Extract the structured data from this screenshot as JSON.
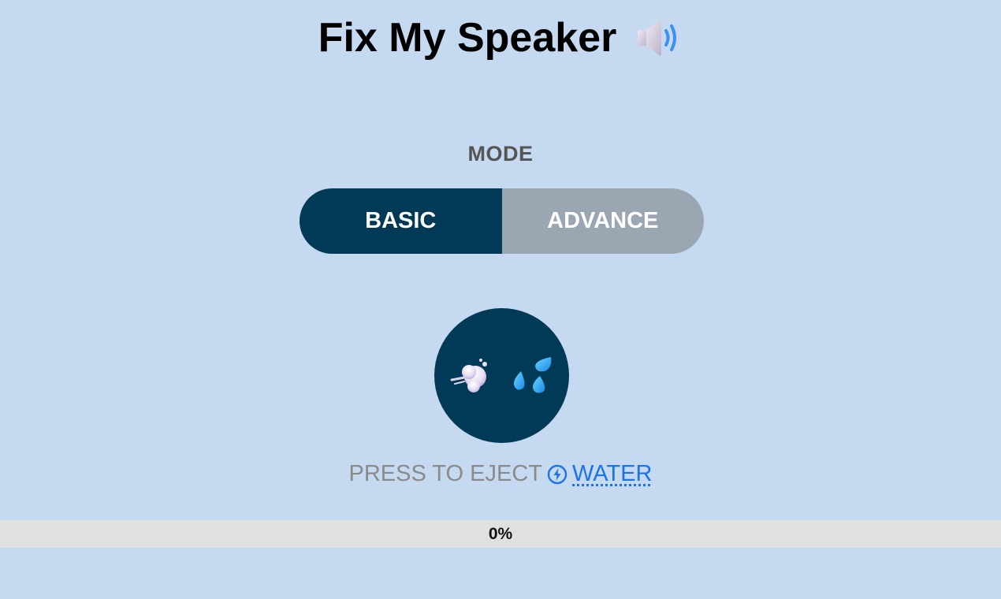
{
  "header": {
    "title": "Fix My Speaker",
    "icon": "speaker-high-volume-icon"
  },
  "mode": {
    "label": "MODE",
    "options": [
      "BASIC",
      "ADVANCE"
    ],
    "selected": "BASIC",
    "active_color": "#003a57",
    "inactive_color": "#9aa7b2"
  },
  "eject": {
    "icons": [
      "dashing-away-icon",
      "sweat-droplets-icon"
    ],
    "caption_prefix": "PRESS TO EJECT",
    "caption_icon": "bolt-circle-icon",
    "caption_link": "WATER"
  },
  "progress": {
    "value": 0,
    "label": "0%"
  },
  "colors": {
    "background": "#c5daf0",
    "accent": "#003a57",
    "link": "#1a73e8",
    "progress_track": "#e0e0e0"
  }
}
